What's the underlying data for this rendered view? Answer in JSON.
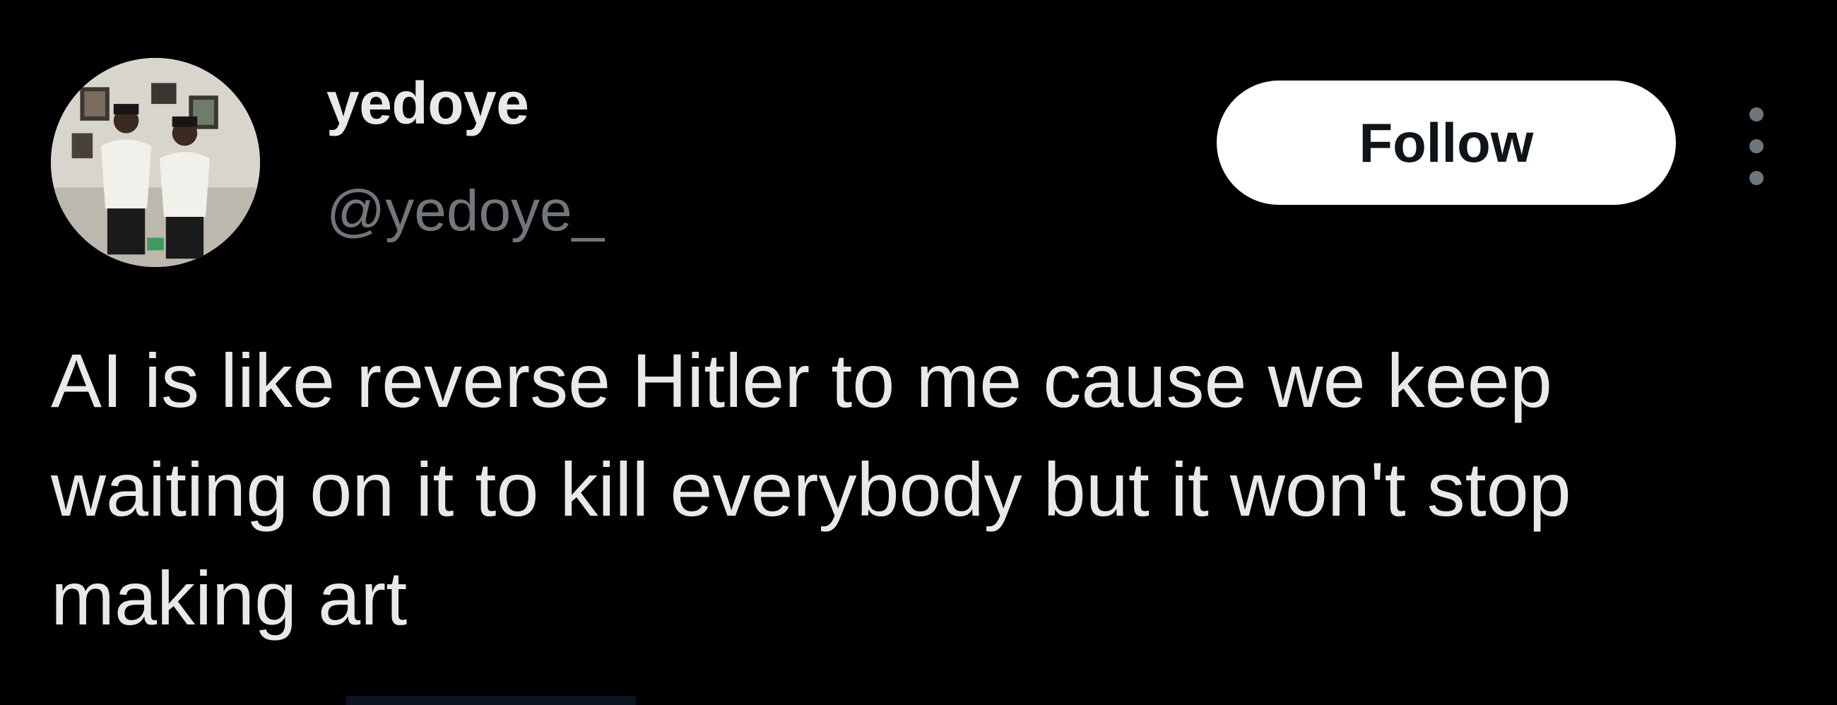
{
  "user": {
    "display_name": "yedoye",
    "handle": "@yedoye_",
    "avatar_icon": "profile-photo"
  },
  "actions": {
    "follow_label": "Follow",
    "more_icon": "more-dots-icon"
  },
  "tweet": {
    "text": "AI is like reverse Hitler to me cause we keep waiting on it to kill everybody but it won't stop making art"
  },
  "colors": {
    "background": "#000000",
    "primary_text": "#e7e9ea",
    "secondary_text": "#71767b",
    "follow_button_bg": "#ffffff",
    "follow_button_text": "#0f1419"
  }
}
